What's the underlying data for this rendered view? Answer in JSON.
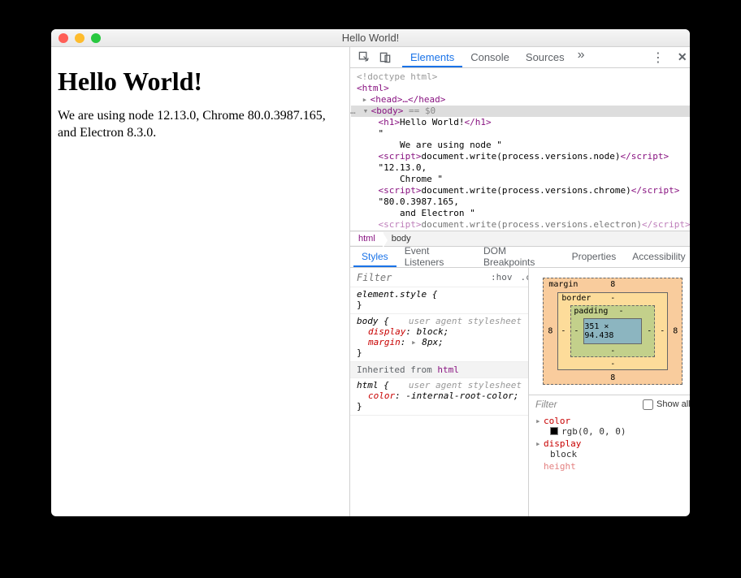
{
  "window": {
    "title": "Hello World!"
  },
  "page": {
    "heading": "Hello World!",
    "body_text": "We are using node 12.13.0, Chrome 80.0.3987.165, and Electron 8.3.0."
  },
  "devtools": {
    "main_tabs": {
      "elements": "Elements",
      "console": "Console",
      "sources": "Sources"
    },
    "dom": {
      "doctype": "<!doctype html>",
      "html_open": "<html>",
      "head": "<head>…</head>",
      "body_open": "<body>",
      "body_sel_suffix": "== $0",
      "h1_open": "<h1>",
      "h1_text": "Hello World!",
      "h1_close": "</h1>",
      "txt1a": "\"",
      "txt1b": "    We are using node \"",
      "script_open": "<script>",
      "script_close": "</script>",
      "s1": "document.write(process.versions.node)",
      "txt2a": "\"12.13.0,",
      "txt2b": "    Chrome \"",
      "s2": "document.write(process.versions.chrome)",
      "txt3a": "\"80.0.3987.165,",
      "txt3b": "    and Electron \"",
      "s3": "document.write(process.versions.electron)"
    },
    "breadcrumb": {
      "root": "html",
      "current": "body"
    },
    "subtabs": {
      "styles": "Styles",
      "el": "Event Listeners",
      "db": "DOM Breakpoints",
      "prop": "Properties",
      "acc": "Accessibility"
    },
    "styles": {
      "filter_placeholder": "Filter",
      "hov": ":hov",
      "cls": ".cls",
      "element_style": "element.style {",
      "brace_close": "}",
      "body_sel": "body {",
      "uas": "user agent stylesheet",
      "p_display": "display",
      "v_display": "block",
      "p_margin": "margin",
      "v_margin": "8px",
      "inherited": "Inherited from ",
      "inherited_from": "html",
      "html_sel": "html {",
      "p_color": "color",
      "v_color": "-internal-root-color"
    },
    "boxmodel": {
      "margin_label": "margin",
      "margin": "8",
      "border_label": "border",
      "border": "-",
      "padding_label": "padding",
      "padding": "-",
      "content": "351 × 94.438"
    },
    "computed": {
      "filter_placeholder": "Filter",
      "show_all": "Show all",
      "color_name": "color",
      "color_val": "rgb(0, 0, 0)",
      "display_name": "display",
      "display_val": "block",
      "height_name": "height"
    }
  }
}
